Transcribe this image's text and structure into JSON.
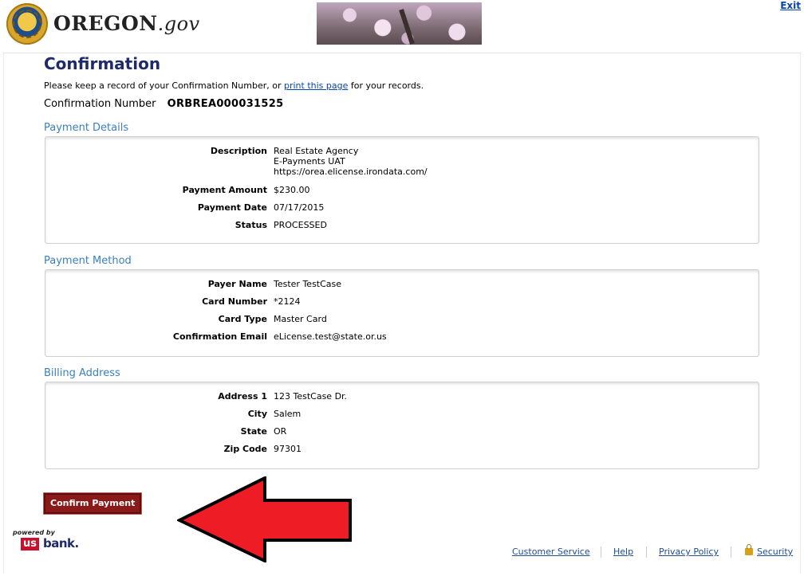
{
  "header": {
    "brand_main": "OREGON",
    "brand_suffix": ".gov",
    "exit_label": "Exit"
  },
  "page": {
    "title": "Confirmation",
    "instructions_before": "Please keep a record of your Confirmation Number, or ",
    "instructions_link": "print this page",
    "instructions_after": " for your records.",
    "confirmation_label": "Confirmation Number",
    "confirmation_number": "ORBREA000031525"
  },
  "payment_details": {
    "title": "Payment Details",
    "rows": [
      {
        "label": "Description",
        "value": "Real Estate Agency\nE-Payments UAT\nhttps://orea.elicense.irondata.com/"
      },
      {
        "label": "Payment Amount",
        "value": "$230.00"
      },
      {
        "label": "Payment Date",
        "value": "07/17/2015"
      },
      {
        "label": "Status",
        "value": "PROCESSED"
      }
    ]
  },
  "payment_method": {
    "title": "Payment Method",
    "rows": [
      {
        "label": "Payer Name",
        "value": "Tester TestCase"
      },
      {
        "label": "Card Number",
        "value": "*2124"
      },
      {
        "label": "Card Type",
        "value": "Master Card"
      },
      {
        "label": "Confirmation Email",
        "value": "eLicense.test@state.or.us"
      }
    ]
  },
  "billing_address": {
    "title": "Billing Address",
    "rows": [
      {
        "label": "Address 1",
        "value": "123 TestCase Dr."
      },
      {
        "label": "City",
        "value": "Salem"
      },
      {
        "label": "State",
        "value": "OR"
      },
      {
        "label": "Zip Code",
        "value": "97301"
      }
    ]
  },
  "actions": {
    "confirm_label": "Confirm Payment"
  },
  "footer": {
    "powered_by": "powered by",
    "logo_us": "us",
    "logo_bank": "bank.",
    "links": [
      "Customer Service",
      "Help",
      "Privacy Policy",
      "Security"
    ]
  },
  "colors": {
    "title": "#1f2a6b",
    "section_title": "#3a7fbf",
    "button": "#8a1a1a",
    "arrow": "#ee1c25",
    "link": "#0645ad"
  },
  "icons": [
    "oregon-seal-icon",
    "lock-icon",
    "red-arrow-annotation"
  ]
}
